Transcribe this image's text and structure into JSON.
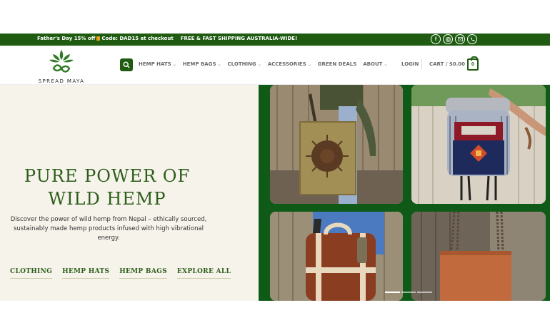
{
  "topbar": {
    "promo_prefix": "Father's Day 15% off",
    "promo_code": "Code: DAD15 at checkout",
    "shipping": "FREE & FAST SHIPPING AUSTRALIA-WIDE!",
    "social_icons": [
      "facebook-icon",
      "instagram-icon",
      "email-icon",
      "phone-icon"
    ],
    "bg_color": "#1f5c12"
  },
  "header": {
    "brand": "SPREAD MAYA",
    "nav": [
      {
        "label": "HEMP HATS",
        "dropdown": true
      },
      {
        "label": "HEMP BAGS",
        "dropdown": true
      },
      {
        "label": "CLOTHING",
        "dropdown": true
      },
      {
        "label": "ACCESSORIES",
        "dropdown": true
      },
      {
        "label": "GREEN DEALS",
        "dropdown": false
      },
      {
        "label": "ABOUT",
        "dropdown": true
      }
    ],
    "login": "LOGIN",
    "cart_label": "CART / $0.00",
    "cart_count": "0"
  },
  "hero": {
    "title_line1": "PURE POWER OF",
    "title_line2": "WILD HEMP",
    "description": "Discover the power of wild hemp from Nepal – ethically sourced, sustainably made hemp products infused with high vibrational energy.",
    "links": [
      "CLOTHING",
      "HEMP HATS",
      "HEMP BAGS",
      "EXPLORE ALL"
    ],
    "accent_color": "#2f5e1c",
    "panel_color": "#0e5a16",
    "images": [
      "olive-sun-tote-bag-photo",
      "mandala-backpack-photo",
      "striped-hemp-backpack-photo",
      "rust-hemp-tote-photo"
    ],
    "slider_active": 0,
    "slider_count": 3
  }
}
